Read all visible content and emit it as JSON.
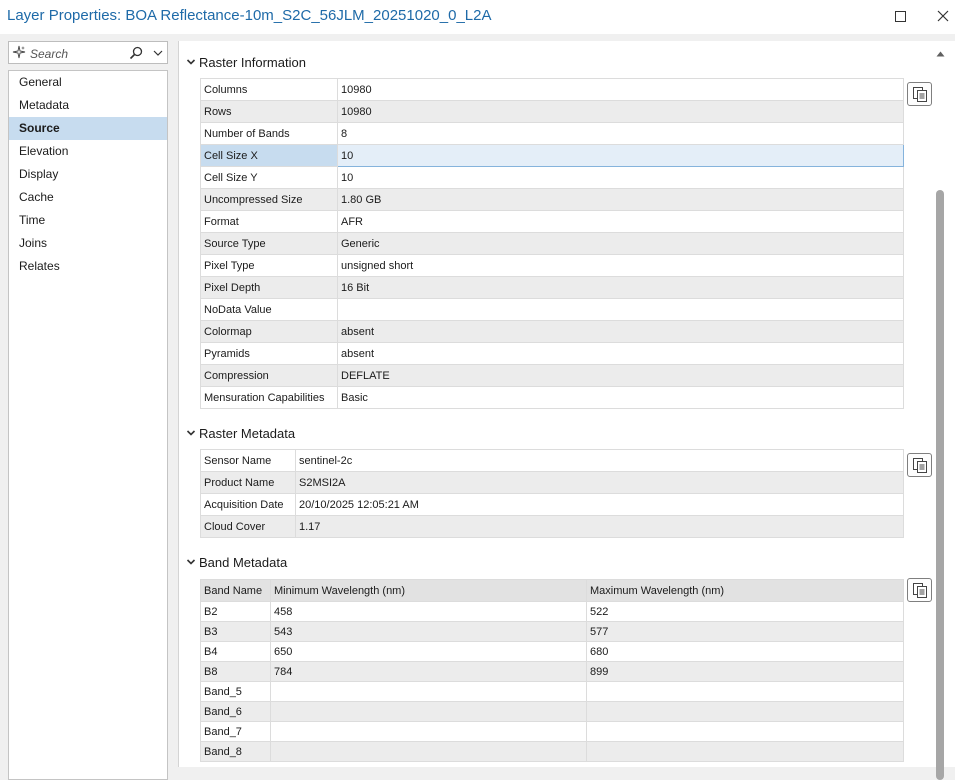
{
  "window": {
    "title": "Layer Properties: BOA Reflectance-10m_S2C_56JLM_20251020_0_L2A"
  },
  "sidebar": {
    "search_placeholder": "Search",
    "items": [
      {
        "label": "General"
      },
      {
        "label": "Metadata"
      },
      {
        "label": "Source"
      },
      {
        "label": "Elevation"
      },
      {
        "label": "Display"
      },
      {
        "label": "Cache"
      },
      {
        "label": "Time"
      },
      {
        "label": "Joins"
      },
      {
        "label": "Relates"
      }
    ],
    "active_item": "Source"
  },
  "raster_information": {
    "heading": "Raster Information",
    "rows": [
      {
        "name": "Columns",
        "value": "10980"
      },
      {
        "name": "Rows",
        "value": "10980"
      },
      {
        "name": "Number of Bands",
        "value": "8"
      },
      {
        "name": "Cell Size X",
        "value": "10"
      },
      {
        "name": "Cell Size Y",
        "value": "10"
      },
      {
        "name": "Uncompressed Size",
        "value": "1.80 GB"
      },
      {
        "name": "Format",
        "value": "AFR"
      },
      {
        "name": "Source Type",
        "value": "Generic"
      },
      {
        "name": "Pixel Type",
        "value": "unsigned short"
      },
      {
        "name": "Pixel Depth",
        "value": "16 Bit"
      },
      {
        "name": "NoData Value",
        "value": ""
      },
      {
        "name": "Colormap",
        "value": "absent"
      },
      {
        "name": "Pyramids",
        "value": "absent"
      },
      {
        "name": "Compression",
        "value": "DEFLATE"
      },
      {
        "name": "Mensuration Capabilities",
        "value": "Basic"
      }
    ],
    "selected_row": "Cell Size X"
  },
  "raster_metadata": {
    "heading": "Raster Metadata",
    "rows": [
      {
        "name": "Sensor Name",
        "value": "sentinel-2c"
      },
      {
        "name": "Product Name",
        "value": "S2MSI2A"
      },
      {
        "name": "Acquisition Date",
        "value": "20/10/2025 12:05:21 AM"
      },
      {
        "name": "Cloud Cover",
        "value": "1.17"
      }
    ]
  },
  "band_metadata": {
    "heading": "Band Metadata",
    "columns": [
      "Band Name",
      "Minimum Wavelength (nm)",
      "Maximum Wavelength (nm)"
    ],
    "rows": [
      [
        "B2",
        "458",
        "522"
      ],
      [
        "B3",
        "543",
        "577"
      ],
      [
        "B4",
        "650",
        "680"
      ],
      [
        "B8",
        "784",
        "899"
      ],
      [
        "Band_5",
        "",
        ""
      ],
      [
        "Band_6",
        "",
        ""
      ],
      [
        "Band_7",
        "",
        ""
      ],
      [
        "Band_8",
        "",
        ""
      ]
    ]
  },
  "icons": {
    "maximize": "maximize-icon",
    "close": "close-icon",
    "search": "search-icon",
    "copy": "copy-icon"
  },
  "colors": {
    "title": "#1e6aa8",
    "selection": "#c7dcef"
  }
}
